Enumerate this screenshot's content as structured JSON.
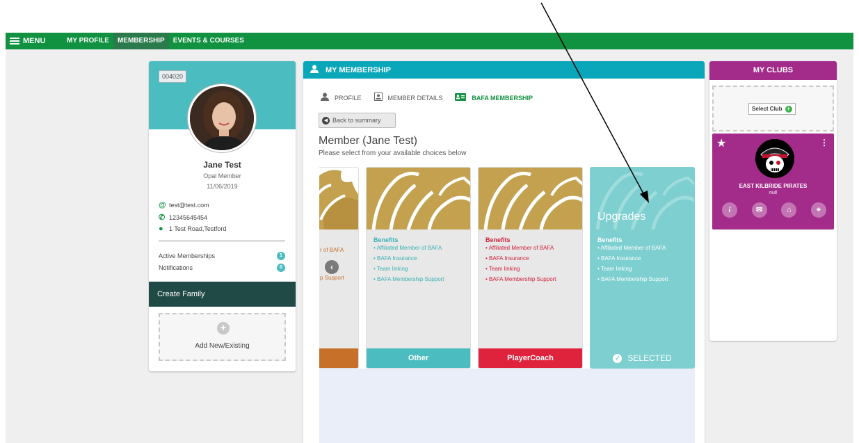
{
  "nav": {
    "menu_label": "MENU",
    "items": [
      {
        "label": "MY PROFILE"
      },
      {
        "label": "MEMBERSHIP"
      },
      {
        "label": "EVENTS & COURSES"
      }
    ]
  },
  "profile": {
    "member_id": "004020",
    "name": "Jane Test",
    "level": "Opal Member",
    "date": "11/06/2019",
    "email": "test@test.com",
    "phone": "12345645454",
    "address": "1 Test Road,Testford",
    "active_memberships_label": "Active Memberships",
    "active_memberships_count": "1",
    "notifications_label": "Notifications",
    "notifications_count": "0",
    "create_family_label": "Create Family",
    "add_new_label": "Add New/Existing"
  },
  "membership": {
    "header": "MY MEMBERSHIP",
    "tabs": [
      {
        "label": "PROFILE",
        "icon": "user-icon"
      },
      {
        "label": "MEMBER DETAILS",
        "icon": "id-card-icon"
      },
      {
        "label": "BAFA MEMBERSHIP",
        "icon": "membership-card-icon"
      }
    ],
    "back_label": "Back to summary",
    "title": "Member (Jane Test)",
    "subtitle": "Please select from your available choices below",
    "partial_card": {
      "benefits": [
        "r of BAFA",
        "p Support"
      ],
      "color": "#c7702a"
    },
    "cards": [
      {
        "benefits_heading": "Benefits",
        "benefits": [
          "Affiliated Member of BAFA",
          "BAFA Insurance",
          "Team linking",
          "BAFA Membership Support"
        ],
        "footer": "Other",
        "color": "#4bbcbf",
        "text_color": "#4bbcbf"
      },
      {
        "benefits_heading": "Benefits",
        "benefits": [
          "Affiliated Member of BAFA",
          "BAFA Insurance",
          "Team linking",
          "BAFA Membership Support"
        ],
        "footer": "PlayerCoach",
        "color": "#e0233d",
        "text_color": "#d0213a"
      },
      {
        "overlay_title": "Upgrades",
        "benefits_heading": "Benefits",
        "benefits": [
          "Affiliated Member of BAFA",
          "BAFA Insurance",
          "Team linking",
          "BAFA Membership Support"
        ],
        "footer": "SELECTED",
        "color": "#7ecfd0",
        "text_color": "#ffffff"
      }
    ]
  },
  "clubs": {
    "header": "MY CLUBS",
    "select_label": "Select Club",
    "club": {
      "name": "EAST KILBRIDE PIRATES",
      "subtitle": "null"
    }
  }
}
